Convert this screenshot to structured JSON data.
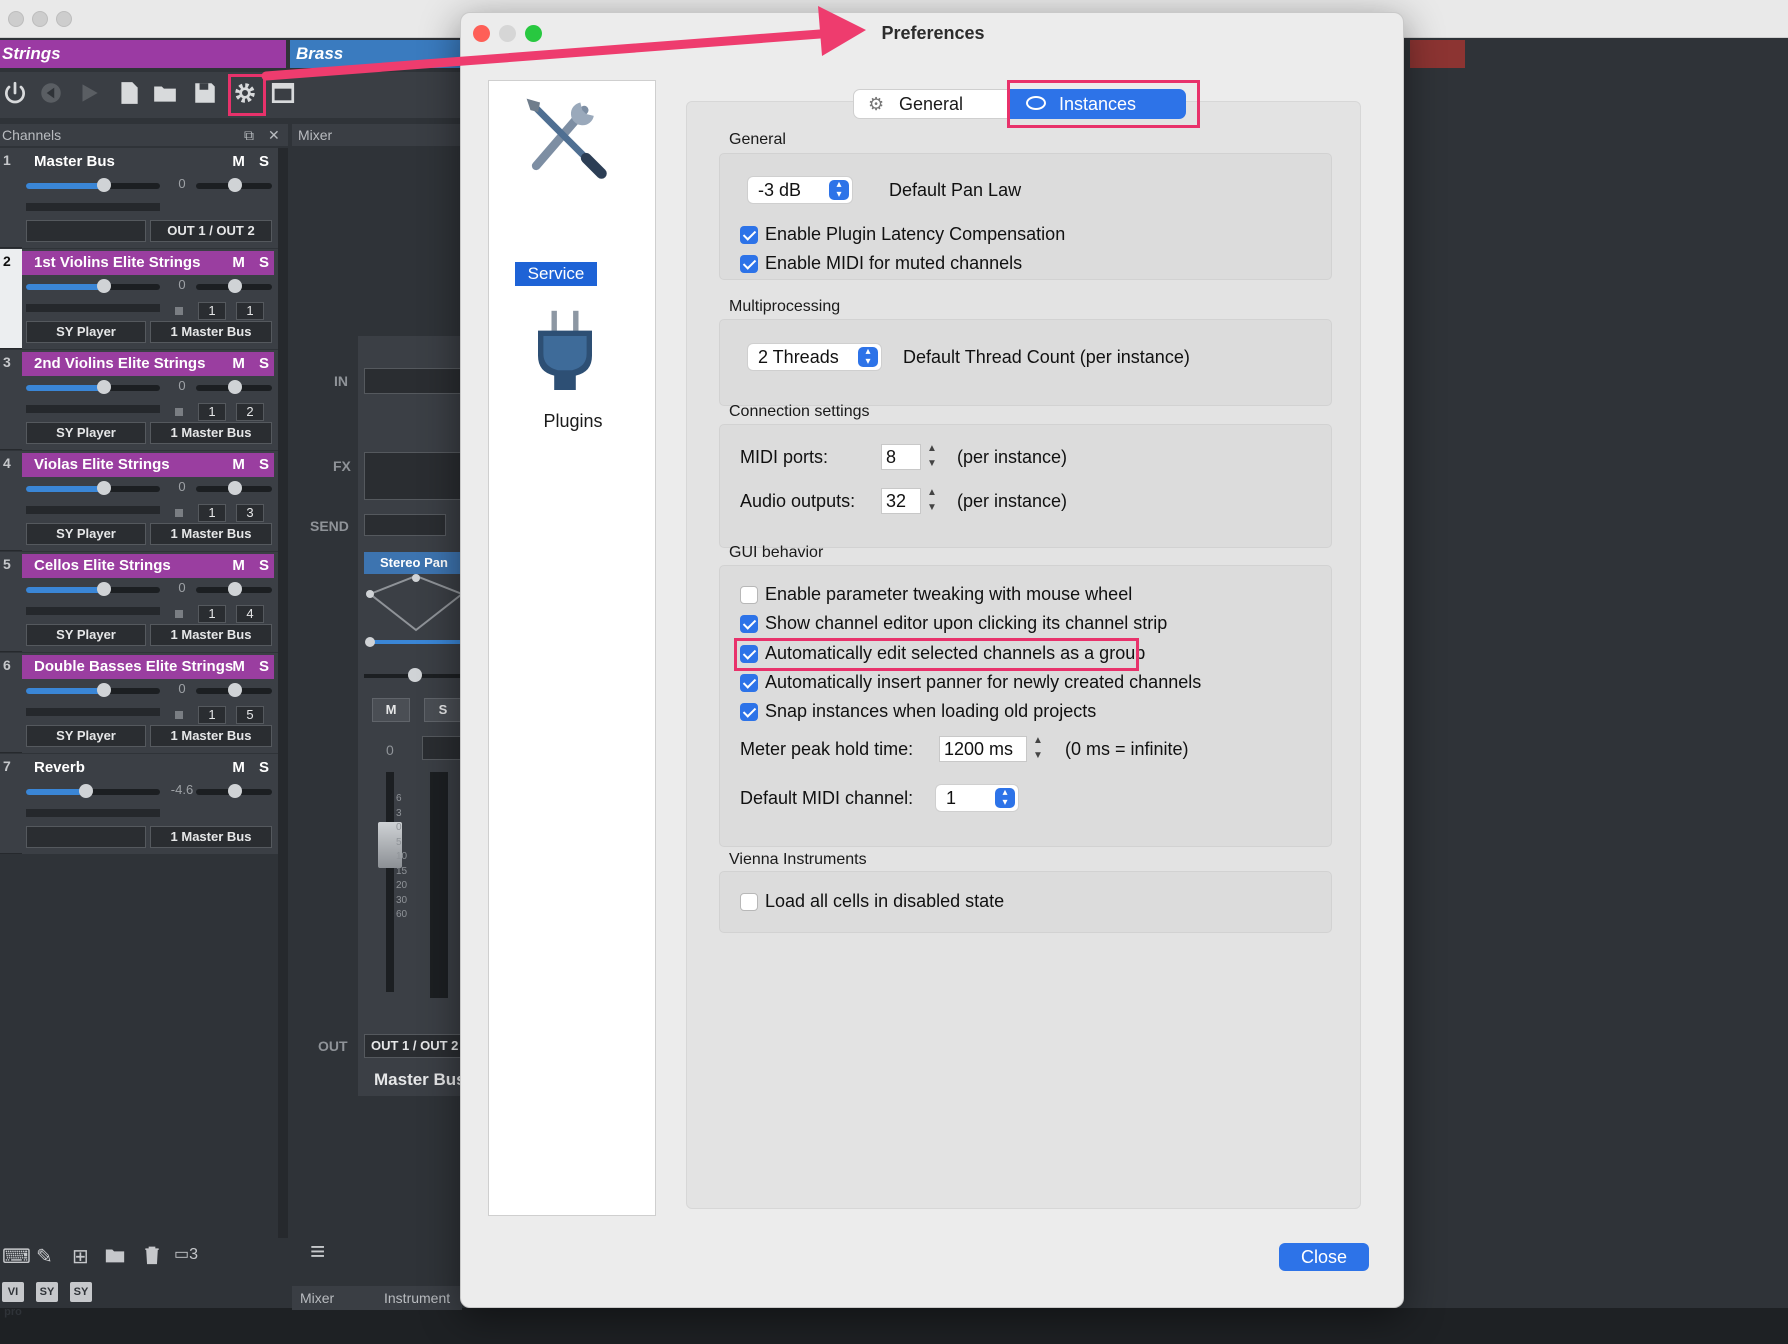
{
  "host": {
    "tabs": [
      "Strings",
      "Brass"
    ],
    "channels_header": "Channels",
    "mixer_header": "Mixer",
    "channels": [
      {
        "num": "1",
        "name": "Master Bus",
        "ms": "M S",
        "purple": false,
        "vol": "0",
        "vol_level": 0.58,
        "selected": false,
        "pos": [],
        "io_left": "",
        "io_right": "OUT 1 / OUT 2"
      },
      {
        "num": "2",
        "name": "1st Violins Elite Strings",
        "ms": "M S",
        "purple": true,
        "vol": "0",
        "vol_level": 0.58,
        "selected": true,
        "pos": [
          "1",
          "1"
        ],
        "io_left": "SY Player",
        "io_right": "1 Master Bus"
      },
      {
        "num": "3",
        "name": "2nd Violins Elite Strings",
        "ms": "M S",
        "purple": true,
        "vol": "0",
        "vol_level": 0.58,
        "selected": false,
        "pos": [
          "1",
          "2"
        ],
        "io_left": "SY Player",
        "io_right": "1 Master Bus"
      },
      {
        "num": "4",
        "name": "Violas Elite Strings",
        "ms": "M S",
        "purple": true,
        "vol": "0",
        "vol_level": 0.58,
        "selected": false,
        "pos": [
          "1",
          "3"
        ],
        "io_left": "SY Player",
        "io_right": "1 Master Bus"
      },
      {
        "num": "5",
        "name": "Cellos Elite Strings",
        "ms": "M S",
        "purple": true,
        "vol": "0",
        "vol_level": 0.58,
        "selected": false,
        "pos": [
          "1",
          "4"
        ],
        "io_left": "SY Player",
        "io_right": "1 Master Bus"
      },
      {
        "num": "6",
        "name": "Double Basses Elite Strings",
        "ms": "M S",
        "purple": true,
        "vol": "0",
        "vol_level": 0.58,
        "selected": false,
        "pos": [
          "1",
          "5"
        ],
        "io_left": "SY Player",
        "io_right": "1 Master Bus"
      },
      {
        "num": "7",
        "name": "Reverb",
        "ms": "M S",
        "purple": false,
        "vol": "-4.6",
        "vol_level": 0.45,
        "selected": false,
        "pos": [],
        "io_left": "",
        "io_right": "1 Master Bus"
      }
    ],
    "mixer": {
      "in": "IN",
      "fx": "FX",
      "send": "SEND",
      "out": "OUT",
      "stereo_pan": "Stereo Pan",
      "mute": "M",
      "solo": "S",
      "level": "0",
      "out_value": "OUT 1 / OUT 2",
      "name": "Master Bus",
      "scale": [
        "6",
        "3",
        "0",
        "5",
        "10",
        "15",
        "20",
        "30",
        "60"
      ]
    },
    "bottom_tabs": [
      "Mixer",
      "Instrument"
    ],
    "bottom_badges": [
      "VI pro",
      "SY",
      "SY"
    ],
    "bottom_icons": [
      "keyboard-icon",
      "pen-icon",
      "add-icon",
      "folder-icon",
      "trash-icon",
      "count-icon"
    ],
    "count_badge": "3"
  },
  "prefs": {
    "title": "Preferences",
    "sidebar": {
      "service": "Service",
      "plugins": "Plugins"
    },
    "tabs": {
      "general": "General",
      "instances": "Instances",
      "active": "instances"
    },
    "sections": {
      "general": "General",
      "multiprocessing": "Multiprocessing",
      "connection": "Connection settings",
      "gui": "GUI behavior",
      "vienna": "Vienna Instruments"
    },
    "general": {
      "pan_law_value": "-3 dB",
      "pan_law_label": "Default Pan Law",
      "latency_comp": {
        "label": "Enable Plugin Latency Compensation",
        "checked": true
      },
      "midi_muted": {
        "label": "Enable MIDI for muted channels",
        "checked": true
      }
    },
    "multiprocessing": {
      "threads_value": "2 Threads",
      "threads_label": "Default Thread Count (per instance)"
    },
    "connection": {
      "midi_ports_label": "MIDI ports:",
      "midi_ports_value": "8",
      "audio_outputs_label": "Audio outputs:",
      "audio_outputs_value": "32",
      "per_instance": "(per instance)"
    },
    "gui": {
      "checks": [
        {
          "label": "Enable parameter tweaking with mouse wheel",
          "checked": false
        },
        {
          "label": "Show channel editor upon clicking its channel strip",
          "checked": true
        },
        {
          "label": "Automatically edit selected channels as a group",
          "checked": true
        },
        {
          "label": "Automatically insert panner for newly created channels",
          "checked": true
        },
        {
          "label": "Snap instances when loading old projects",
          "checked": true
        }
      ],
      "meter_label": "Meter peak hold time:",
      "meter_value": "1200 ms",
      "meter_hint": "(0 ms = infinite)",
      "midi_channel_label": "Default MIDI channel:",
      "midi_channel_value": "1"
    },
    "vienna": {
      "load_disabled": {
        "label": "Load all cells in disabled state",
        "checked": false
      }
    },
    "close": "Close"
  },
  "colors": {
    "accent": "#2d73e8",
    "highlight": "#e8326b",
    "strings_tab": "#9b3aa3",
    "brass_tab": "#3a7bbf"
  }
}
